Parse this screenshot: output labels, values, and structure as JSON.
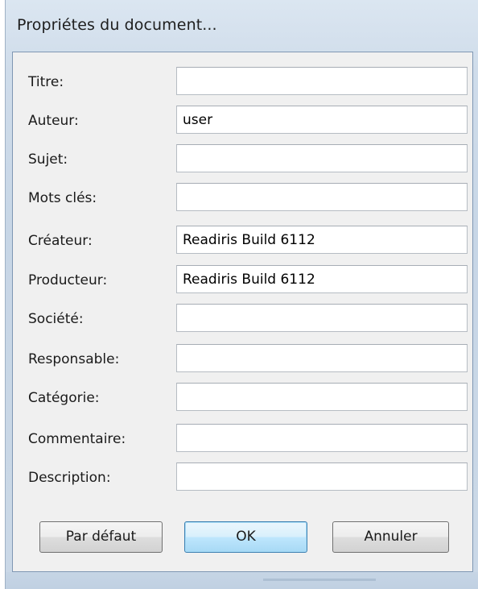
{
  "dialog": {
    "title": "Propriétes du document..."
  },
  "fields": [
    {
      "label": "Titre:",
      "value": ""
    },
    {
      "label": "Auteur:",
      "value": "user"
    },
    {
      "label": "Sujet:",
      "value": ""
    },
    {
      "label": "Mots clés:",
      "value": ""
    },
    {
      "label": "Créateur:",
      "value": "Readiris Build 6112"
    },
    {
      "label": "Producteur:",
      "value": "Readiris Build 6112"
    },
    {
      "label": "Société:",
      "value": ""
    },
    {
      "label": "Responsable:",
      "value": ""
    },
    {
      "label": "Catégorie:",
      "value": ""
    },
    {
      "label": "Commentaire:",
      "value": ""
    },
    {
      "label": "Description:",
      "value": ""
    }
  ],
  "buttons": {
    "default_label": "Par défaut",
    "ok_label": "OK",
    "cancel_label": "Annuler"
  },
  "colors": {
    "frame": "#cfdcea",
    "client": "#f0f0f0",
    "default_button_border": "#3c7fb1"
  }
}
